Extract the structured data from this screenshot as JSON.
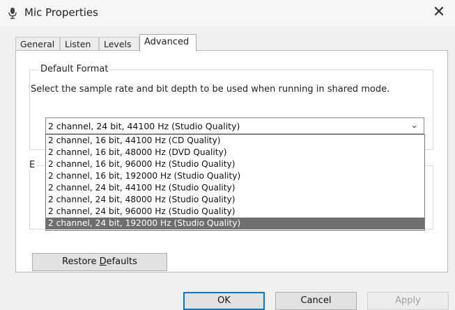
{
  "window": {
    "title": "Mic Properties",
    "icon": "microphone-icon",
    "close_glyph": "✕"
  },
  "tabs": [
    {
      "label": "General",
      "active": false
    },
    {
      "label": "Listen",
      "active": false
    },
    {
      "label": "Levels",
      "active": false
    },
    {
      "label": "Advanced",
      "active": true
    }
  ],
  "default_format": {
    "group_title": "Default Format",
    "description": "Select the sample rate and bit depth to be used when running in shared mode.",
    "selected_value": "2 channel, 24 bit, 44100 Hz (Studio Quality)",
    "chevron": "⌄",
    "options": [
      "2 channel, 16 bit, 44100 Hz (CD Quality)",
      "2 channel, 16 bit, 48000 Hz (DVD Quality)",
      "2 channel, 16 bit, 96000 Hz (Studio Quality)",
      "2 channel, 16 bit, 192000 Hz (Studio Quality)",
      "2 channel, 24 bit, 44100 Hz (Studio Quality)",
      "2 channel, 24 bit, 48000 Hz (Studio Quality)",
      "2 channel, 24 bit, 96000 Hz (Studio Quality)",
      "2 channel, 24 bit, 192000 Hz (Studio Quality)"
    ],
    "highlighted_option_index": 7
  },
  "exclusive_group": {
    "title_fragment": "E"
  },
  "restore_defaults": {
    "label_prefix": "Restore ",
    "label_access": "D",
    "label_suffix": "efaults"
  },
  "buttons": {
    "ok": "OK",
    "cancel": "Cancel",
    "apply": "Apply"
  },
  "colors": {
    "highlight": "#6f6f6f",
    "ok_focus": "#0078d7"
  }
}
